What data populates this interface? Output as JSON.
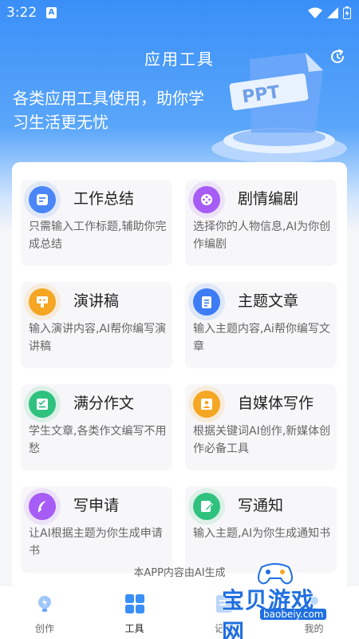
{
  "status_bar": {
    "time": "3:22",
    "notif_letter": "A"
  },
  "header": {
    "title": "应用工具",
    "subtitle": "各类应用工具使用，助你学习生活更无忧",
    "illustration_text": "PPT"
  },
  "cards": [
    {
      "title": "工作总结",
      "desc": "只需输入工作标题,辅助你完成总结",
      "icon": "document-icon",
      "color": "#4a86f7"
    },
    {
      "title": "剧情编剧",
      "desc": "选择你的人物信息,AI为你创作编剧",
      "icon": "film-reel-icon",
      "color": "#a65cf5"
    },
    {
      "title": "演讲稿",
      "desc": "输入演讲内容,AI帮你编写演讲稿",
      "icon": "podium-icon",
      "color": "#f5a623"
    },
    {
      "title": "主题文章",
      "desc": "输入主题内容,Ai帮你编写文章",
      "icon": "clipboard-list-icon",
      "color": "#3d7cf5"
    },
    {
      "title": "满分作文",
      "desc": "学生文章,各类作文编写不用愁",
      "icon": "checklist-icon",
      "color": "#2ec27e"
    },
    {
      "title": "自媒体写作",
      "desc": "根据关键词AI创作,新媒体创作必备工具",
      "icon": "person-card-icon",
      "color": "#f5a623"
    },
    {
      "title": "写申请",
      "desc": "让AI根据主题为你生成申请书",
      "icon": "feather-icon",
      "color": "#a65cf5"
    },
    {
      "title": "写通知",
      "desc": "输入主题,AI为你生成通知书",
      "icon": "edit-note-icon",
      "color": "#2ec27e"
    }
  ],
  "footer_note": "本APP内容由AI生成",
  "tabs": [
    {
      "label": "创作",
      "icon": "bulb-icon",
      "active": false
    },
    {
      "label": "工具",
      "icon": "grid-icon",
      "active": true
    },
    {
      "label": "记录",
      "icon": "record-icon",
      "active": false
    },
    {
      "label": "我的",
      "icon": "user-icon",
      "active": false
    }
  ],
  "watermark": {
    "text": "宝贝游戏网",
    "url": "baobeiy.com"
  }
}
